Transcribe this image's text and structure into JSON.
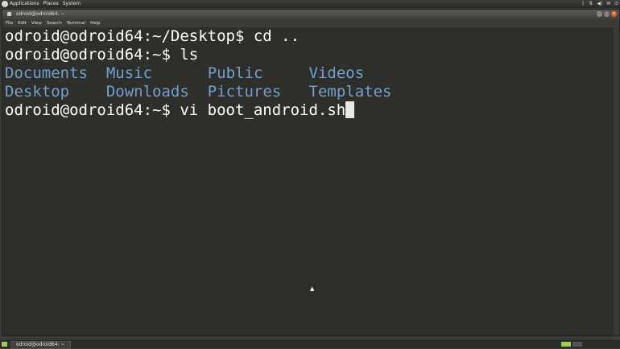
{
  "top_panel": {
    "menus": [
      "Applications",
      "Places",
      "System"
    ]
  },
  "window": {
    "title": "odroid@odroid64: ~",
    "menu": [
      "File",
      "Edit",
      "View",
      "Search",
      "Terminal",
      "Help"
    ],
    "buttons": {
      "minimize": "–",
      "maximize": "□",
      "close": "×"
    }
  },
  "terminal": {
    "line1": "odroid@odroid64:~/Desktop$ cd ..",
    "line2": "odroid@odroid64:~$ ls",
    "ls_row1": [
      "Documents",
      "Music",
      "Public",
      "Videos"
    ],
    "ls_row2": [
      "Desktop",
      "Downloads",
      "Pictures",
      "Templates"
    ],
    "line4": "odroid@odroid64:~$ vi boot_android.sh",
    "dir_color": "#729fcf"
  },
  "bottom_panel": {
    "task": "odroid@odroid64: ~"
  }
}
